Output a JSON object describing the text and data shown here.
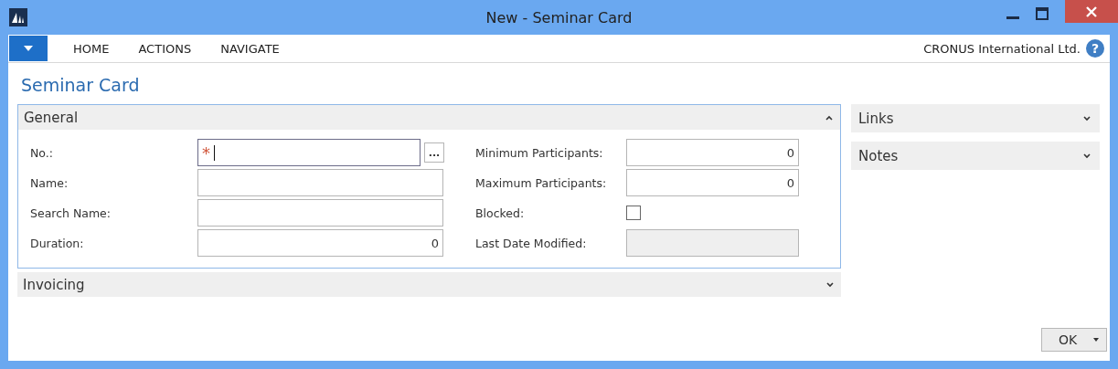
{
  "window": {
    "title": "New - Seminar Card"
  },
  "menu": {
    "tabs": [
      {
        "label": "HOME",
        "selected": false
      },
      {
        "label": "ACTIONS",
        "selected": false
      },
      {
        "label": "NAVIGATE",
        "selected": false
      }
    ],
    "company": "CRONUS International Ltd.",
    "help": "?"
  },
  "page_title": "Seminar Card",
  "general": {
    "title": "General",
    "expanded": true,
    "left": [
      {
        "label": "No.:",
        "kind": "required",
        "marker": "*",
        "lookup": "..."
      },
      {
        "label": "Name:",
        "kind": "text"
      },
      {
        "label": "Search Name:",
        "kind": "text"
      },
      {
        "label": "Duration:",
        "kind": "number",
        "value": "0"
      }
    ],
    "right": [
      {
        "label": "Minimum Participants:",
        "kind": "number",
        "value": "0"
      },
      {
        "label": "Maximum Participants:",
        "kind": "number",
        "value": "0"
      },
      {
        "label": "Blocked:",
        "kind": "checkbox",
        "checked": false
      },
      {
        "label": "Last Date Modified:",
        "kind": "disabled"
      }
    ]
  },
  "invoicing": {
    "title": "Invoicing",
    "expanded": false
  },
  "factboxes": [
    {
      "title": "Links",
      "expanded": false
    },
    {
      "title": "Notes",
      "expanded": false
    }
  ],
  "ok_button": "OK"
}
